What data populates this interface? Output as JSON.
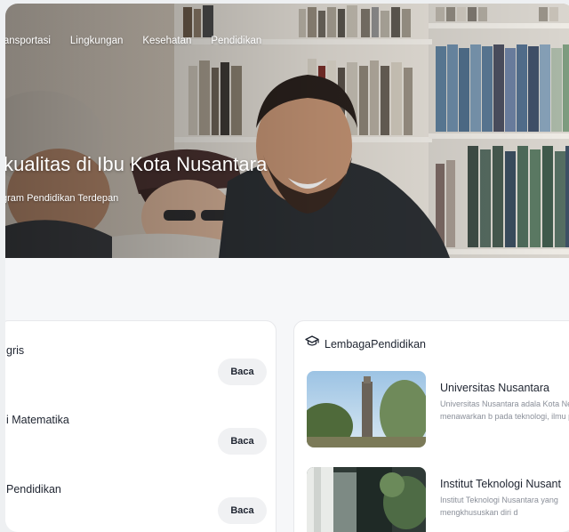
{
  "nav": {
    "items": [
      "ransportasi",
      "Lingkungan",
      "Kesehatan",
      "Pendidikan"
    ]
  },
  "hero": {
    "title": "kualitas di Ibu Kota Nusantara",
    "subtitle": "gram Pendidikan Terdepan"
  },
  "articles": [
    {
      "title": "gris",
      "action": "Baca"
    },
    {
      "title": "i Matematika",
      "action": "Baca"
    },
    {
      "title": "Pendidikan",
      "action": "Baca"
    }
  ],
  "institutions": {
    "header": "LembagaPendidikan",
    "header_icon": "graduation-cap-icon",
    "items": [
      {
        "name": "Universitas Nusantara",
        "description": "Universitas Nusantara adala Kota Negara, menawarkan b pada teknologi, ilmu penget"
      },
      {
        "name": "Institut Teknologi Nusant",
        "description": "Institut Teknologi Nusantara yang mengkhususkan diri d"
      }
    ]
  },
  "colors": {
    "page_bg": "#f6f7f9",
    "card_bg": "#ffffff",
    "button_bg": "#f0f1f3",
    "text_dark": "#1e2430",
    "text_muted": "#8a8f99"
  }
}
